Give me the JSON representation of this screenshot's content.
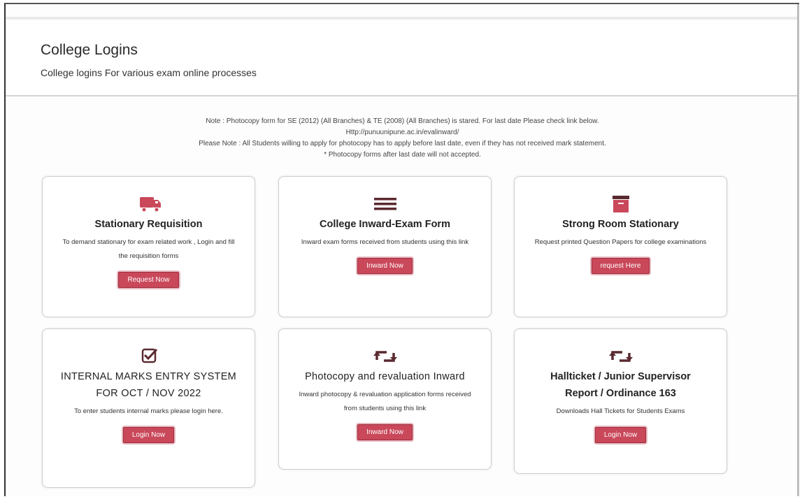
{
  "header": {
    "title": "College Logins",
    "subtitle": "College logins For various exam online processes"
  },
  "notes": [
    "Note : Photocopy form for SE (2012) (All Branches) & TE (2008) (All Branches) is stared. For last date Please check link below.",
    "Http://punuunipune.ac.in/evalinward/",
    "Please Note : All Students willing to apply for photocopy has to apply before last date, even if they has not received mark statement.",
    "* Photocopy forms after last date will not accepted."
  ],
  "cards": [
    {
      "icon": "truck-icon",
      "title": "Stationary Requisition",
      "desc": "To demand stationary for exam related work , Login and fill the requisition forms",
      "button": "Request Now"
    },
    {
      "icon": "list-icon",
      "title": "College Inward-Exam Form",
      "desc": "Inward exam forms received from students using this link",
      "button": "Inward Now"
    },
    {
      "icon": "archive-icon",
      "title": "Strong Room Stationary",
      "desc": "Request printed Question Papers for college examinations",
      "button": "request Here"
    },
    {
      "icon": "checkbox-icon",
      "title": "INTERNAL MARKS ENTRY SYSTEM FOR OCT / NOV 2022",
      "desc": "To enter students internal marks please login here.",
      "button": "Login Now"
    },
    {
      "icon": "retweet-icon",
      "title": "Photocopy and revaluation Inward",
      "desc": "Inward photocopy & revaluation application forms received from students using this link",
      "button": "Inward Now"
    },
    {
      "icon": "retweet-icon",
      "title": "Hallticket / Junior Supervisor Report / Ordinance 163",
      "desc": "Downloads Hall Tickets for Students Exams",
      "button": "Login Now"
    }
  ],
  "colors": {
    "accent": "#c9485a",
    "accent_border": "#9e2d3d"
  }
}
